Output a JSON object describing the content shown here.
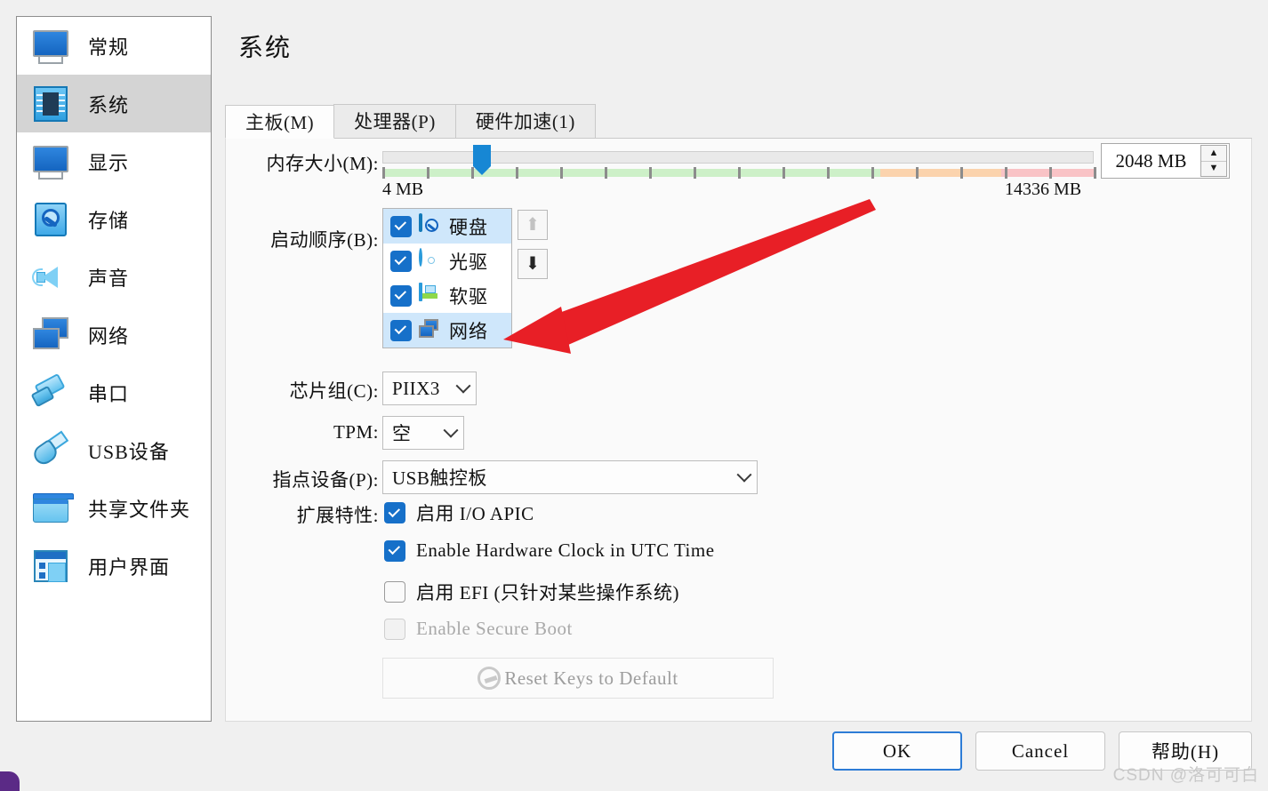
{
  "window": {
    "title": "系统",
    "background": "#f0f0f0"
  },
  "sidebar": {
    "items": [
      {
        "label": "常规",
        "icon": "monitor-icon",
        "selected": false
      },
      {
        "label": "系统",
        "icon": "chip-icon",
        "selected": true
      },
      {
        "label": "显示",
        "icon": "display-icon",
        "selected": false
      },
      {
        "label": "存储",
        "icon": "harddisk-icon",
        "selected": false
      },
      {
        "label": "声音",
        "icon": "speaker-icon",
        "selected": false
      },
      {
        "label": "网络",
        "icon": "network-icon",
        "selected": false
      },
      {
        "label": "串口",
        "icon": "serialport-icon",
        "selected": false
      },
      {
        "label": "USB设备",
        "icon": "usb-icon",
        "selected": false
      },
      {
        "label": "共享文件夹",
        "icon": "folder-icon",
        "selected": false
      },
      {
        "label": "用户界面",
        "icon": "userinterface-icon",
        "selected": false
      }
    ]
  },
  "tabs": [
    {
      "label": "主板(M)",
      "active": true
    },
    {
      "label": "处理器(P)",
      "active": false
    },
    {
      "label": "硬件加速(1)",
      "active": false
    }
  ],
  "memory": {
    "label": "内存大小(M):",
    "min_label": "4 MB",
    "max_label": "14336 MB",
    "value_label": "2048 MB",
    "min": 4,
    "max": 14336,
    "value": 2048,
    "handle_percent": 14,
    "green_end_percent": 70,
    "orange_end_percent": 87,
    "track_green": "#cdf0c8",
    "track_orange": "#fbd3ad",
    "track_red": "#f9c3c6"
  },
  "boot_order": {
    "label": "启动顺序(B):",
    "items": [
      {
        "label": "硬盘",
        "icon": "harddisk-icon",
        "checked": true,
        "highlighted": true
      },
      {
        "label": "光驱",
        "icon": "optical-icon",
        "checked": true,
        "highlighted": false
      },
      {
        "label": "软驱",
        "icon": "floppy-icon",
        "checked": true,
        "highlighted": false
      },
      {
        "label": "网络",
        "icon": "network-icon",
        "checked": true,
        "highlighted": true
      }
    ],
    "move_up": {
      "name": "move-up-arrow",
      "glyph": "⬆",
      "enabled": false
    },
    "move_down": {
      "name": "move-down-arrow",
      "glyph": "⬇",
      "enabled": true
    }
  },
  "chipset": {
    "label": "芯片组(C):",
    "value": "PIIX3"
  },
  "tpm": {
    "label": "TPM:",
    "value": "空"
  },
  "pointing": {
    "label": "指点设备(P):",
    "value": "USB触控板"
  },
  "extended": {
    "label": "扩展特性:",
    "options": [
      {
        "label": "启用 I/O APIC",
        "checked": true,
        "enabled": true
      },
      {
        "label": "Enable Hardware Clock in UTC Time",
        "checked": true,
        "enabled": true
      },
      {
        "label": "启用 EFI (只针对某些操作系统)",
        "checked": false,
        "enabled": true
      },
      {
        "label": "Enable Secure Boot",
        "checked": false,
        "enabled": false
      }
    ],
    "reset_button": {
      "label": "Reset Keys to Default",
      "icon": "reset-icon",
      "enabled": false
    }
  },
  "footer": {
    "ok": "OK",
    "cancel": "Cancel",
    "help": "帮助(H)"
  },
  "annotation": {
    "color": "#e81f26",
    "points_to": "网络"
  },
  "watermark": "CSDN @洛可可白"
}
